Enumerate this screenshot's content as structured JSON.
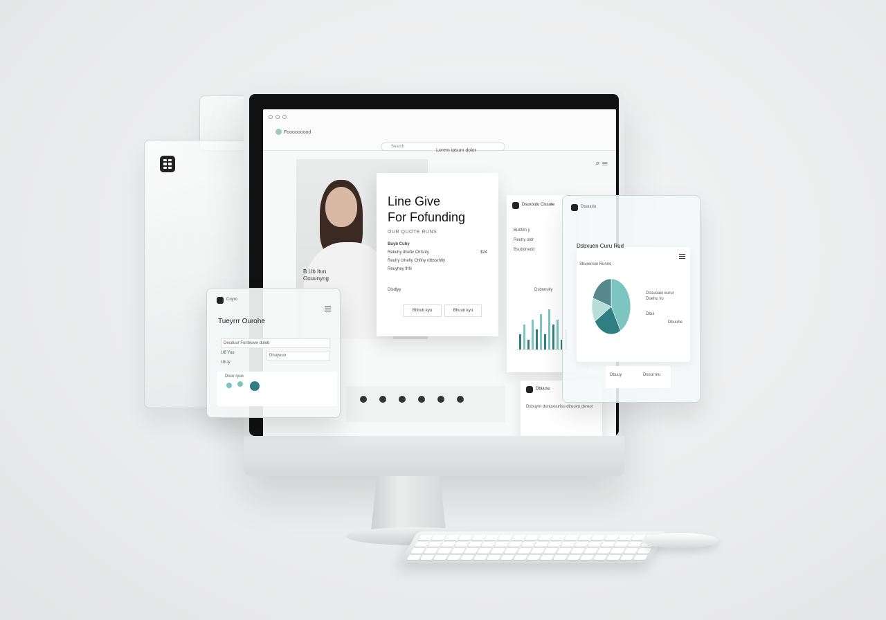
{
  "colors": {
    "accent": "#2f7f82",
    "accent_light": "#7cc5c1",
    "accent_pale": "#b7dedb",
    "dark": "#1f2a2c"
  },
  "browser": {
    "tab_title": "Fooooooood",
    "url_placeholder": "Search",
    "site_title": "Lorem ipsum dolor"
  },
  "hero": {
    "title": "Line Give\nFor Fofunding",
    "subtitle": "OUR QUOTE RUNS",
    "caption": "B Ub Itun\nOouunyng",
    "section_label": "Buyb Cuhy",
    "items": [
      "Rekuhy dhefiv Chfsnly",
      "Reuhy crhefiy Chfiny rdbssrhfiy",
      "Reuyhey fhfii"
    ],
    "price": "$24",
    "footer_label": "Dlsdlyy",
    "button_primary": "Bhbub kyu",
    "button_secondary": "Bhuun kyu"
  },
  "stats_card": {
    "title": "Dsuxoutu Clssute",
    "items": [
      "Bubfdn y",
      "Reuhy oldr",
      "Bsubdnedd"
    ],
    "chart_label": "Dsbnnuily"
  },
  "panel_left": {
    "brand": "Coyro",
    "title": "Tueyrrr Ourohe",
    "field_1": "Decduur Funbiuvw dulob",
    "field_2_label": "U8 Yuu",
    "field_2_value": "Dhuyuuo",
    "field_3": "Ub ly",
    "section": "Dsuv ryue"
  },
  "panel_right": {
    "brand": "Dsuuulu",
    "card_title": "Dsbxuen Curu Rud",
    "subtitle": "Sbuoeruw Runno",
    "legend_title": "Dssuoaei eurur",
    "legend_sub": "Duehu vu",
    "stat_a": "Dbui",
    "stat_b": "Dbuuhe",
    "footer_a": "Dbuuy",
    "footer_b": "Dsoul mu"
  },
  "mail_card": {
    "title": "Dbuusu",
    "text": "Dsbuynr dunuvuurlsu diruuvu dsruur"
  },
  "chart_data": [
    {
      "type": "bar",
      "series": [
        {
          "values": [
            3,
            5,
            2,
            6,
            4,
            7,
            3,
            8,
            5,
            6,
            2,
            4
          ]
        }
      ]
    },
    {
      "type": "pie",
      "series": [
        {
          "values": [
            42,
            24,
            14,
            20
          ]
        }
      ]
    }
  ]
}
